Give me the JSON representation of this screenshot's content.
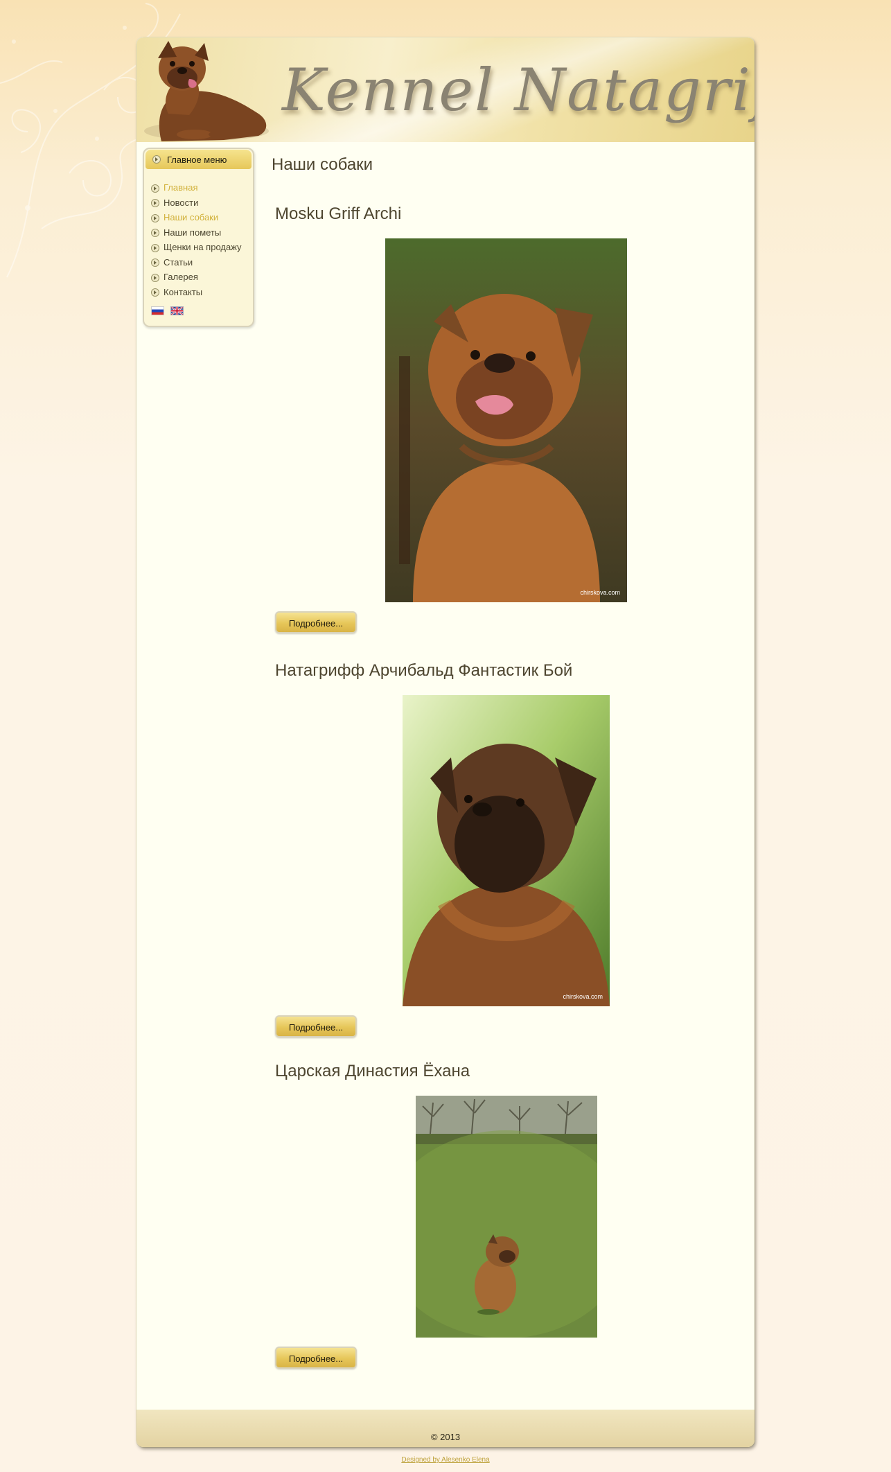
{
  "header": {
    "logo_text": "Kennel Natagriff"
  },
  "sidebar": {
    "menu_title": "Главное меню",
    "items": [
      {
        "label": "Главная",
        "active": true
      },
      {
        "label": "Новости",
        "active": false
      },
      {
        "label": "Наши собаки",
        "active": true
      },
      {
        "label": "Наши пометы",
        "active": false
      },
      {
        "label": "Щенки на продажу",
        "active": false
      },
      {
        "label": "Статьи",
        "active": false
      },
      {
        "label": "Галерея",
        "active": false
      },
      {
        "label": "Контакты",
        "active": false
      }
    ],
    "languages": [
      "ru-flag-icon",
      "gb-flag-icon"
    ]
  },
  "main": {
    "page_title": "Наши собаки",
    "dogs": [
      {
        "name": "Mosku Griff Archi",
        "photo_credit": "chirskova.com",
        "more_label": "Подробнее..."
      },
      {
        "name": "Натагрифф Арчибальд Фантастик Бой",
        "photo_credit": "chirskova.com",
        "more_label": "Подробнее..."
      },
      {
        "name": "Царская Династия Ёхана",
        "photo_credit": "",
        "more_label": "Подробнее..."
      }
    ]
  },
  "footer": {
    "copyright": "© 2013",
    "designer_link": "Designed by Alesenko Elena"
  },
  "colors": {
    "accent": "#d1b13b",
    "text": "#4e4630",
    "content_bg": "#fffff2"
  }
}
